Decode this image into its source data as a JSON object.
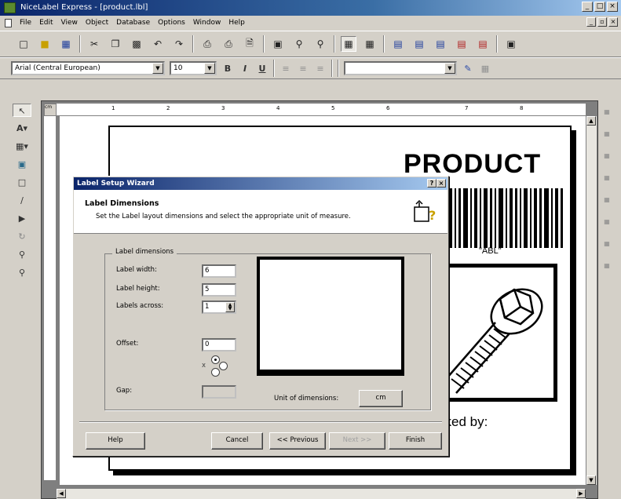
{
  "app": {
    "title": "NiceLabel Express - [product.lbl]",
    "window_buttons": [
      "_",
      "□",
      "×"
    ],
    "mdi_buttons": [
      "_",
      "▫",
      "×"
    ]
  },
  "menu": {
    "items": [
      "File",
      "Edit",
      "View",
      "Object",
      "Database",
      "Options",
      "Window",
      "Help"
    ]
  },
  "toolbar2": {
    "font_name": "Arial (Central European)",
    "font_size": "10",
    "bold": "B",
    "italic": "I",
    "underline": "U",
    "variable_combo": ""
  },
  "ruler": {
    "corner": "cm",
    "labels": [
      "1",
      "2",
      "3",
      "4",
      "5",
      "6",
      "7",
      "8"
    ]
  },
  "label_design": {
    "title": "PRODUCT",
    "barcode_text": "\"ABL\"",
    "footer_text": "cked by:"
  },
  "dialog": {
    "title": "Label Setup Wizard",
    "help_glyph": "?",
    "close_glyph": "×",
    "heading": "Label Dimensions",
    "subheading": "Set the Label layout dimensions and select the appropriate unit of measure.",
    "group_title": "Label dimensions",
    "label_width": {
      "label": "Label width:",
      "value": "6"
    },
    "label_height": {
      "label": "Label height:",
      "value": "5"
    },
    "labels_across": {
      "label": "Labels across:",
      "value": "1"
    },
    "offset": {
      "label": "Offset:",
      "value": "0"
    },
    "gap": {
      "label": "Gap:",
      "value": ""
    },
    "unit_label": "Unit of dimensions:",
    "unit_value": "cm",
    "buttons": {
      "help": "Help",
      "cancel": "Cancel",
      "previous": "<< Previous",
      "next": "Next >>",
      "finish": "Finish"
    }
  }
}
